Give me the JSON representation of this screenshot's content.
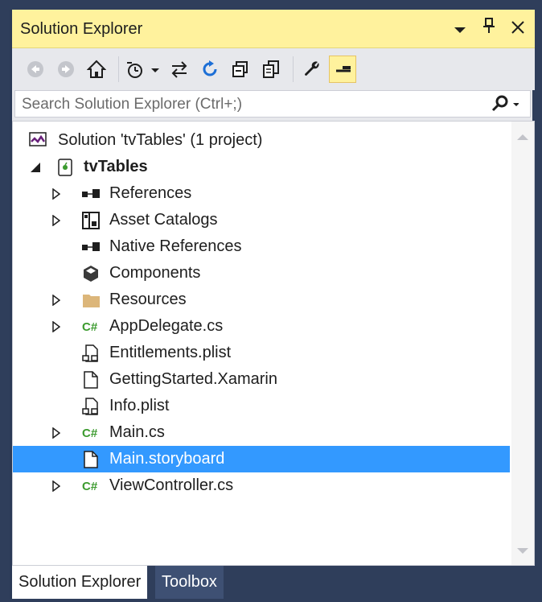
{
  "window": {
    "title": "Solution Explorer"
  },
  "titlebar_icons": [
    "chevron-down-icon",
    "pin-icon",
    "close-icon"
  ],
  "toolbar": {
    "buttons": [
      "back-icon",
      "forward-icon",
      "home-icon",
      "history-icon",
      "sync-icon",
      "refresh-icon",
      "collapse-all-icon",
      "copy-icon",
      "properties-wrench-icon",
      "preview-icon"
    ]
  },
  "search": {
    "placeholder": "Search Solution Explorer (Ctrl+;)"
  },
  "tree": {
    "solution": "Solution 'tvTables' (1 project)",
    "project": "tvTables",
    "items": [
      {
        "label": "References",
        "icon": "references-icon",
        "expandable": true
      },
      {
        "label": "Asset Catalogs",
        "icon": "asset-catalog-icon",
        "expandable": true
      },
      {
        "label": "Native References",
        "icon": "references-icon",
        "expandable": false
      },
      {
        "label": "Components",
        "icon": "components-icon",
        "expandable": false
      },
      {
        "label": "Resources",
        "icon": "folder-icon",
        "expandable": true
      },
      {
        "label": "AppDelegate.cs",
        "icon": "csharp-icon",
        "expandable": true
      },
      {
        "label": "Entitlements.plist",
        "icon": "plist-icon",
        "expandable": false
      },
      {
        "label": "GettingStarted.Xamarin",
        "icon": "file-icon",
        "expandable": false
      },
      {
        "label": "Info.plist",
        "icon": "plist-icon",
        "expandable": false
      },
      {
        "label": "Main.cs",
        "icon": "csharp-icon",
        "expandable": true
      },
      {
        "label": "Main.storyboard",
        "icon": "file-icon",
        "expandable": false,
        "selected": true
      },
      {
        "label": "ViewController.cs",
        "icon": "csharp-icon",
        "expandable": true
      }
    ]
  },
  "tabs": {
    "active": "Solution Explorer",
    "inactive": "Toolbox"
  },
  "colors": {
    "titlebar": "#fff29d",
    "selection": "#3399ff",
    "csharp": "#3c9b2f",
    "vs_purple": "#68217a"
  }
}
